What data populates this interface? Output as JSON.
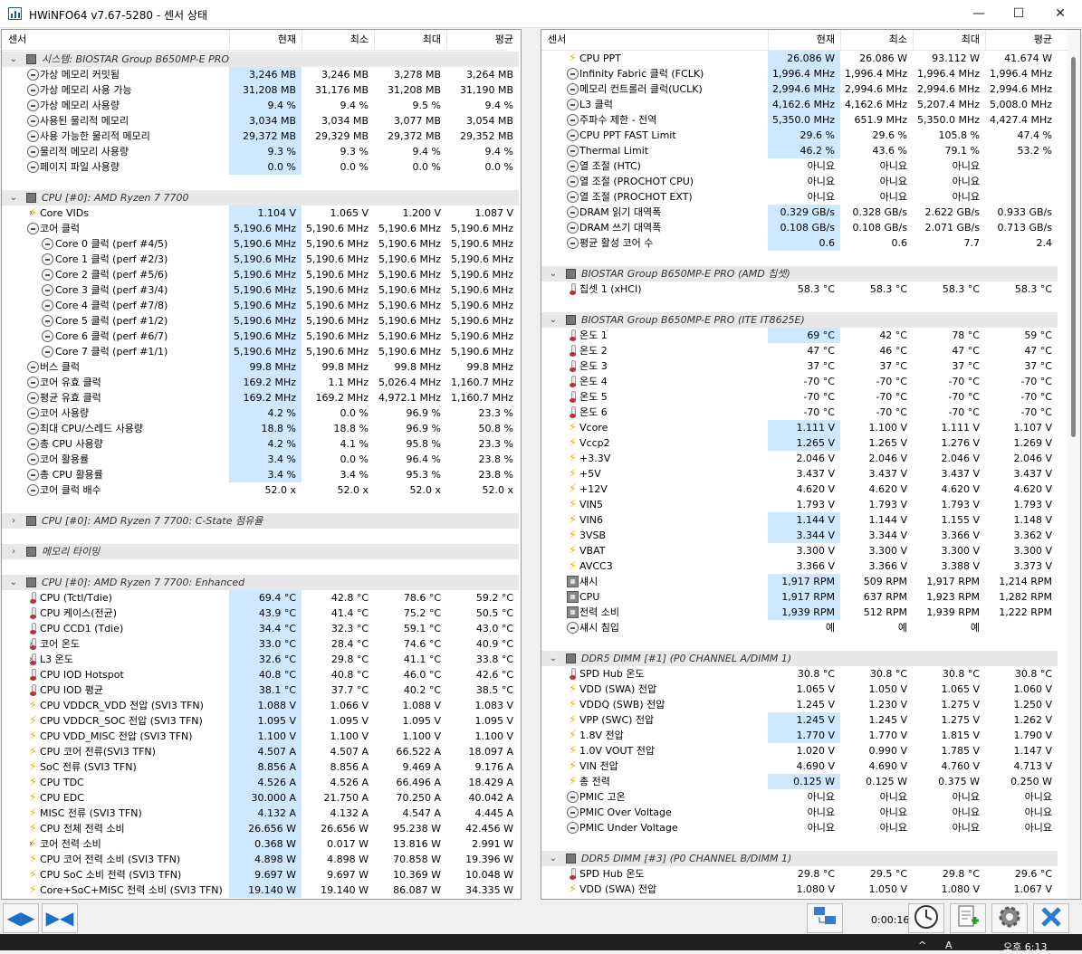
{
  "window": {
    "title": "HWiNFO64 v7.67-5280 - 센서 상태",
    "minimize": "—",
    "maximize": "☐",
    "close": "✕"
  },
  "columns": {
    "sensor": "센서",
    "current": "현재",
    "min": "최소",
    "max": "최대",
    "avg": "평균"
  },
  "left_rows": [
    {
      "t": "s",
      "lvl": 0,
      "ex": "v",
      "icon": "chip",
      "label": "시스템: BIOSTAR Group B650MP-E PRO"
    },
    {
      "lvl": 1,
      "icon": "clock",
      "label": "가상 메모리 커밋됨",
      "v": [
        "3,246 MB",
        "3,246 MB",
        "3,278 MB",
        "3,264 MB"
      ]
    },
    {
      "lvl": 1,
      "icon": "clock",
      "label": "가상 메모리 사용 가능",
      "v": [
        "31,208 MB",
        "31,176 MB",
        "31,208 MB",
        "31,190 MB"
      ]
    },
    {
      "lvl": 1,
      "icon": "clock",
      "label": "가상 메모리 사용량",
      "v": [
        "9.4 %",
        "9.4 %",
        "9.5 %",
        "9.4 %"
      ]
    },
    {
      "lvl": 1,
      "icon": "clock",
      "label": "사용된 물리적 메모리",
      "v": [
        "3,034 MB",
        "3,034 MB",
        "3,077 MB",
        "3,054 MB"
      ]
    },
    {
      "lvl": 1,
      "icon": "clock",
      "label": "사용 가능한 물리적 메모리",
      "v": [
        "29,372 MB",
        "29,329 MB",
        "29,372 MB",
        "29,352 MB"
      ]
    },
    {
      "lvl": 1,
      "icon": "clock",
      "label": "물리적 메모리 사용량",
      "v": [
        "9.3 %",
        "9.3 %",
        "9.4 %",
        "9.4 %"
      ]
    },
    {
      "lvl": 1,
      "icon": "clock",
      "label": "페이지 파일 사용량",
      "v": [
        "0.0 %",
        "0.0 %",
        "0.0 %",
        "0.0 %"
      ]
    },
    {
      "t": "gap"
    },
    {
      "t": "s",
      "lvl": 0,
      "ex": "v",
      "icon": "chip",
      "label": "CPU [#0]: AMD Ryzen 7 7700"
    },
    {
      "lvl": 1,
      "ex": ">",
      "icon": "bolt",
      "label": "Core VIDs",
      "v": [
        "1.104 V",
        "1.065 V",
        "1.200 V",
        "1.087 V"
      ]
    },
    {
      "lvl": 1,
      "ex": "v",
      "icon": "clock",
      "label": "코어 클럭",
      "v": [
        "5,190.6 MHz",
        "5,190.6 MHz",
        "5,190.6 MHz",
        "5,190.6 MHz"
      ]
    },
    {
      "lvl": 2,
      "icon": "clock",
      "label": "Core 0 클럭 (perf #4/5)",
      "v": [
        "5,190.6 MHz",
        "5,190.6 MHz",
        "5,190.6 MHz",
        "5,190.6 MHz"
      ]
    },
    {
      "lvl": 2,
      "icon": "clock",
      "label": "Core 1 클럭 (perf #2/3)",
      "v": [
        "5,190.6 MHz",
        "5,190.6 MHz",
        "5,190.6 MHz",
        "5,190.6 MHz"
      ]
    },
    {
      "lvl": 2,
      "icon": "clock",
      "label": "Core 2 클럭 (perf #5/6)",
      "v": [
        "5,190.6 MHz",
        "5,190.6 MHz",
        "5,190.6 MHz",
        "5,190.6 MHz"
      ]
    },
    {
      "lvl": 2,
      "icon": "clock",
      "label": "Core 3 클럭 (perf #3/4)",
      "v": [
        "5,190.6 MHz",
        "5,190.6 MHz",
        "5,190.6 MHz",
        "5,190.6 MHz"
      ]
    },
    {
      "lvl": 2,
      "icon": "clock",
      "label": "Core 4 클럭 (perf #7/8)",
      "v": [
        "5,190.6 MHz",
        "5,190.6 MHz",
        "5,190.6 MHz",
        "5,190.6 MHz"
      ]
    },
    {
      "lvl": 2,
      "icon": "clock",
      "label": "Core 5 클럭 (perf #1/2)",
      "v": [
        "5,190.6 MHz",
        "5,190.6 MHz",
        "5,190.6 MHz",
        "5,190.6 MHz"
      ]
    },
    {
      "lvl": 2,
      "icon": "clock",
      "label": "Core 6 클럭 (perf #6/7)",
      "v": [
        "5,190.6 MHz",
        "5,190.6 MHz",
        "5,190.6 MHz",
        "5,190.6 MHz"
      ]
    },
    {
      "lvl": 2,
      "icon": "clock",
      "label": "Core 7 클럭 (perf #1/1)",
      "v": [
        "5,190.6 MHz",
        "5,190.6 MHz",
        "5,190.6 MHz",
        "5,190.6 MHz"
      ]
    },
    {
      "lvl": 1,
      "icon": "clock",
      "label": "버스 클럭",
      "v": [
        "99.8 MHz",
        "99.8 MHz",
        "99.8 MHz",
        "99.8 MHz"
      ]
    },
    {
      "lvl": 1,
      "ex": ">",
      "icon": "clock",
      "label": "코어 유효 클럭",
      "v": [
        "169.2 MHz",
        "1.1 MHz",
        "5,026.4 MHz",
        "1,160.7 MHz"
      ]
    },
    {
      "lvl": 1,
      "icon": "clock",
      "label": "평균 유효 클럭",
      "v": [
        "169.2 MHz",
        "169.2 MHz",
        "4,972.1 MHz",
        "1,160.7 MHz"
      ]
    },
    {
      "lvl": 1,
      "ex": ">",
      "icon": "clock",
      "label": "코어 사용량",
      "v": [
        "4.2 %",
        "0.0 %",
        "96.9 %",
        "23.3 %"
      ]
    },
    {
      "lvl": 1,
      "icon": "clock",
      "label": "최대 CPU/스레드 사용량",
      "v": [
        "18.8 %",
        "18.8 %",
        "96.9 %",
        "50.8 %"
      ]
    },
    {
      "lvl": 1,
      "icon": "clock",
      "label": "총 CPU 사용량",
      "v": [
        "4.2 %",
        "4.1 %",
        "95.8 %",
        "23.3 %"
      ]
    },
    {
      "lvl": 1,
      "ex": ">",
      "icon": "clock",
      "label": "코어 활용률",
      "v": [
        "3.4 %",
        "0.0 %",
        "96.4 %",
        "23.8 %"
      ]
    },
    {
      "lvl": 1,
      "icon": "clock",
      "label": "총 CPU 활용률",
      "v": [
        "3.4 %",
        "3.4 %",
        "95.3 %",
        "23.8 %"
      ]
    },
    {
      "lvl": 1,
      "ex": ">",
      "icon": "clock",
      "label": "코어 클럭 배수",
      "v": [
        "52.0 x",
        "52.0 x",
        "52.0 x",
        "52.0 x"
      ],
      "nohl": true
    },
    {
      "t": "gap"
    },
    {
      "t": "s",
      "lvl": 0,
      "ex": ">",
      "icon": "chip",
      "label": "CPU [#0]: AMD Ryzen 7 7700: C-State 점유율"
    },
    {
      "t": "gap"
    },
    {
      "t": "s",
      "lvl": 0,
      "ex": ">",
      "icon": "chip",
      "label": "메모리 타이밍"
    },
    {
      "t": "gap"
    },
    {
      "t": "s",
      "lvl": 0,
      "ex": "v",
      "icon": "chip",
      "label": "CPU [#0]: AMD Ryzen 7 7700: Enhanced"
    },
    {
      "lvl": 1,
      "icon": "therm",
      "label": "CPU (Tctl/Tdie)",
      "v": [
        "69.4 °C",
        "42.8 °C",
        "78.6 °C",
        "59.2 °C"
      ]
    },
    {
      "lvl": 1,
      "icon": "therm",
      "label": "CPU 케이스(전균)",
      "v": [
        "43.9 °C",
        "41.4 °C",
        "75.2 °C",
        "50.5 °C"
      ]
    },
    {
      "lvl": 1,
      "icon": "therm",
      "label": "CPU CCD1 (Tdie)",
      "v": [
        "34.4 °C",
        "32.3 °C",
        "59.1 °C",
        "43.0 °C"
      ]
    },
    {
      "lvl": 1,
      "ex": ">",
      "icon": "therm",
      "label": "코어 온도",
      "v": [
        "33.0 °C",
        "28.4 °C",
        "74.6 °C",
        "40.9 °C"
      ]
    },
    {
      "lvl": 1,
      "ex": ">",
      "icon": "therm",
      "label": "L3 온도",
      "v": [
        "32.6 °C",
        "29.8 °C",
        "41.1 °C",
        "33.8 °C"
      ]
    },
    {
      "lvl": 1,
      "icon": "therm",
      "label": "CPU IOD Hotspot",
      "v": [
        "40.8 °C",
        "40.8 °C",
        "46.0 °C",
        "42.6 °C"
      ]
    },
    {
      "lvl": 1,
      "icon": "therm",
      "label": "CPU IOD 평균",
      "v": [
        "38.1 °C",
        "37.7 °C",
        "40.2 °C",
        "38.5 °C"
      ]
    },
    {
      "lvl": 1,
      "icon": "bolt",
      "label": "CPU VDDCR_VDD 전압 (SVI3 TFN)",
      "v": [
        "1.088 V",
        "1.066 V",
        "1.088 V",
        "1.083 V"
      ]
    },
    {
      "lvl": 1,
      "icon": "bolt",
      "label": "CPU VDDCR_SOC 전압 (SVI3 TFN)",
      "v": [
        "1.095 V",
        "1.095 V",
        "1.095 V",
        "1.095 V"
      ]
    },
    {
      "lvl": 1,
      "icon": "bolt",
      "label": "CPU VDD_MISC 전압 (SVI3 TFN)",
      "v": [
        "1.100 V",
        "1.100 V",
        "1.100 V",
        "1.100 V"
      ]
    },
    {
      "lvl": 1,
      "icon": "bolt",
      "label": "CPU 코어 전류(SVI3 TFN)",
      "v": [
        "4.507 A",
        "4.507 A",
        "66.522 A",
        "18.097 A"
      ]
    },
    {
      "lvl": 1,
      "icon": "bolt",
      "label": "SoC 전류 (SVI3 TFN)",
      "v": [
        "8.856 A",
        "8.856 A",
        "9.469 A",
        "9.176 A"
      ]
    },
    {
      "lvl": 1,
      "icon": "bolt",
      "label": "CPU TDC",
      "v": [
        "4.526 A",
        "4.526 A",
        "66.496 A",
        "18.429 A"
      ]
    },
    {
      "lvl": 1,
      "icon": "bolt",
      "label": "CPU EDC",
      "v": [
        "30.000 A",
        "21.750 A",
        "70.250 A",
        "40.042 A"
      ]
    },
    {
      "lvl": 1,
      "icon": "bolt",
      "label": "MISC 전류 (SVI3 TFN)",
      "v": [
        "4.132 A",
        "4.132 A",
        "4.547 A",
        "4.445 A"
      ]
    },
    {
      "lvl": 1,
      "icon": "bolt",
      "label": "CPU 전체 전력 소비",
      "v": [
        "26.656 W",
        "26.656 W",
        "95.238 W",
        "42.456 W"
      ]
    },
    {
      "lvl": 1,
      "ex": ">",
      "icon": "bolt",
      "label": "코어 전력 소비",
      "v": [
        "0.368 W",
        "0.017 W",
        "13.816 W",
        "2.991 W"
      ]
    },
    {
      "lvl": 1,
      "icon": "bolt",
      "label": "CPU 코어 전력 소비 (SVI3 TFN)",
      "v": [
        "4.898 W",
        "4.898 W",
        "70.858 W",
        "19.396 W"
      ]
    },
    {
      "lvl": 1,
      "icon": "bolt",
      "label": "CPU SoC 소비 전력 (SVI3 TFN)",
      "v": [
        "9.697 W",
        "9.697 W",
        "10.369 W",
        "10.048 W"
      ]
    },
    {
      "lvl": 1,
      "icon": "bolt",
      "label": "Core+SoC+MISC 전력 소비 (SVI3 TFN)",
      "v": [
        "19.140 W",
        "19.140 W",
        "86.087 W",
        "34.335 W"
      ]
    }
  ],
  "right_rows": [
    {
      "lvl": 1,
      "icon": "bolt",
      "label": "CPU PPT",
      "v": [
        "26.086 W",
        "26.086 W",
        "93.112 W",
        "41.674 W"
      ]
    },
    {
      "lvl": 1,
      "icon": "clock",
      "label": "Infinity Fabric 클럭 (FCLK)",
      "v": [
        "1,996.4 MHz",
        "1,996.4 MHz",
        "1,996.4 MHz",
        "1,996.4 MHz"
      ]
    },
    {
      "lvl": 1,
      "icon": "clock",
      "label": "메모리 컨트롤러 클럭(UCLK)",
      "v": [
        "2,994.6 MHz",
        "2,994.6 MHz",
        "2,994.6 MHz",
        "2,994.6 MHz"
      ]
    },
    {
      "lvl": 1,
      "ex": ">",
      "icon": "clock",
      "label": "L3 클럭",
      "v": [
        "4,162.6 MHz",
        "4,162.6 MHz",
        "5,207.4 MHz",
        "5,008.0 MHz"
      ]
    },
    {
      "lvl": 1,
      "icon": "clock",
      "label": "주파수 제한 - 전역",
      "v": [
        "5,350.0 MHz",
        "651.9 MHz",
        "5,350.0 MHz",
        "4,427.4 MHz"
      ]
    },
    {
      "lvl": 1,
      "icon": "clock",
      "label": "CPU PPT FAST Limit",
      "v": [
        "29.6 %",
        "29.6 %",
        "105.8 %",
        "47.4 %"
      ]
    },
    {
      "lvl": 1,
      "icon": "clock",
      "label": "Thermal Limit",
      "v": [
        "46.2 %",
        "43.6 %",
        "79.1 %",
        "53.2 %"
      ]
    },
    {
      "lvl": 1,
      "icon": "clock",
      "label": "열 조절 (HTC)",
      "v": [
        "아니요",
        "아니요",
        "아니요",
        ""
      ],
      "nohl": true
    },
    {
      "lvl": 1,
      "icon": "clock",
      "label": "열 조절 (PROCHOT CPU)",
      "v": [
        "아니요",
        "아니요",
        "아니요",
        ""
      ],
      "nohl": true
    },
    {
      "lvl": 1,
      "icon": "clock",
      "label": "열 조절 (PROCHOT EXT)",
      "v": [
        "아니요",
        "아니요",
        "아니요",
        ""
      ],
      "nohl": true
    },
    {
      "lvl": 1,
      "icon": "clock",
      "label": "DRAM 읽기 대역폭",
      "v": [
        "0.329 GB/s",
        "0.328 GB/s",
        "2.622 GB/s",
        "0.933 GB/s"
      ]
    },
    {
      "lvl": 1,
      "icon": "clock",
      "label": "DRAM 쓰기 대역폭",
      "v": [
        "0.108 GB/s",
        "0.108 GB/s",
        "2.071 GB/s",
        "0.713 GB/s"
      ]
    },
    {
      "lvl": 1,
      "icon": "clock",
      "label": "평균 활성 코어 수",
      "v": [
        "0.6",
        "0.6",
        "7.7",
        "2.4"
      ]
    },
    {
      "t": "gap"
    },
    {
      "t": "s",
      "lvl": 0,
      "ex": "v",
      "icon": "chip",
      "label": "BIOSTAR Group B650MP-E PRO (AMD 칩셋)"
    },
    {
      "lvl": 1,
      "icon": "therm",
      "label": "칩셋 1 (xHCI)",
      "v": [
        "58.3 °C",
        "58.3 °C",
        "58.3 °C",
        "58.3 °C"
      ],
      "nohl": true
    },
    {
      "t": "gap"
    },
    {
      "t": "s",
      "lvl": 0,
      "ex": "v",
      "icon": "chip",
      "label": "BIOSTAR Group B650MP-E PRO (ITE IT8625E)"
    },
    {
      "lvl": 1,
      "icon": "therm",
      "label": "온도 1",
      "v": [
        "69 °C",
        "42 °C",
        "78 °C",
        "59 °C"
      ]
    },
    {
      "lvl": 1,
      "icon": "therm",
      "label": "온도 2",
      "v": [
        "47 °C",
        "46 °C",
        "47 °C",
        "47 °C"
      ],
      "nohl": true
    },
    {
      "lvl": 1,
      "icon": "therm",
      "label": "온도 3",
      "v": [
        "37 °C",
        "37 °C",
        "37 °C",
        "37 °C"
      ],
      "nohl": true
    },
    {
      "lvl": 1,
      "icon": "therm",
      "label": "온도 4",
      "v": [
        "-70 °C",
        "-70 °C",
        "-70 °C",
        "-70 °C"
      ],
      "nohl": true
    },
    {
      "lvl": 1,
      "icon": "therm",
      "label": "온도 5",
      "v": [
        "-70 °C",
        "-70 °C",
        "-70 °C",
        "-70 °C"
      ],
      "nohl": true
    },
    {
      "lvl": 1,
      "icon": "therm",
      "label": "온도 6",
      "v": [
        "-70 °C",
        "-70 °C",
        "-70 °C",
        "-70 °C"
      ],
      "nohl": true
    },
    {
      "lvl": 1,
      "icon": "bolt",
      "label": "Vcore",
      "v": [
        "1.111 V",
        "1.100 V",
        "1.111 V",
        "1.107 V"
      ]
    },
    {
      "lvl": 1,
      "icon": "bolt",
      "label": "Vccp2",
      "v": [
        "1.265 V",
        "1.265 V",
        "1.276 V",
        "1.269 V"
      ]
    },
    {
      "lvl": 1,
      "icon": "bolt",
      "label": "+3.3V",
      "v": [
        "2.046 V",
        "2.046 V",
        "2.046 V",
        "2.046 V"
      ],
      "nohl": true
    },
    {
      "lvl": 1,
      "icon": "bolt",
      "label": "+5V",
      "v": [
        "3.437 V",
        "3.437 V",
        "3.437 V",
        "3.437 V"
      ],
      "nohl": true
    },
    {
      "lvl": 1,
      "icon": "bolt",
      "label": "+12V",
      "v": [
        "4.620 V",
        "4.620 V",
        "4.620 V",
        "4.620 V"
      ],
      "nohl": true
    },
    {
      "lvl": 1,
      "icon": "bolt",
      "label": "VIN5",
      "v": [
        "1.793 V",
        "1.793 V",
        "1.793 V",
        "1.793 V"
      ],
      "nohl": true
    },
    {
      "lvl": 1,
      "icon": "bolt",
      "label": "VIN6",
      "v": [
        "1.144 V",
        "1.144 V",
        "1.155 V",
        "1.148 V"
      ]
    },
    {
      "lvl": 1,
      "icon": "bolt",
      "label": "3VSB",
      "v": [
        "3.344 V",
        "3.344 V",
        "3.366 V",
        "3.362 V"
      ]
    },
    {
      "lvl": 1,
      "icon": "bolt",
      "label": "VBAT",
      "v": [
        "3.300 V",
        "3.300 V",
        "3.300 V",
        "3.300 V"
      ],
      "nohl": true
    },
    {
      "lvl": 1,
      "icon": "bolt",
      "label": "AVCC3",
      "v": [
        "3.366 V",
        "3.366 V",
        "3.388 V",
        "3.373 V"
      ],
      "nohl": true
    },
    {
      "lvl": 1,
      "icon": "fan",
      "label": "섀시",
      "v": [
        "1,917 RPM",
        "509 RPM",
        "1,917 RPM",
        "1,214 RPM"
      ]
    },
    {
      "lvl": 1,
      "icon": "fan",
      "label": "CPU",
      "v": [
        "1,917 RPM",
        "637 RPM",
        "1,923 RPM",
        "1,282 RPM"
      ]
    },
    {
      "lvl": 1,
      "icon": "fan",
      "label": "전력 소비",
      "v": [
        "1,939 RPM",
        "512 RPM",
        "1,939 RPM",
        "1,222 RPM"
      ]
    },
    {
      "lvl": 1,
      "icon": "clock",
      "label": "섀시 침입",
      "v": [
        "예",
        "예",
        "예",
        ""
      ],
      "nohl": true
    },
    {
      "t": "gap"
    },
    {
      "t": "s",
      "lvl": 0,
      "ex": "v",
      "icon": "chip",
      "label": "DDR5 DIMM [#1] (P0 CHANNEL A/DIMM 1)"
    },
    {
      "lvl": 1,
      "icon": "therm",
      "label": "SPD Hub 온도",
      "v": [
        "30.8 °C",
        "30.8 °C",
        "30.8 °C",
        "30.8 °C"
      ],
      "nohl": true
    },
    {
      "lvl": 1,
      "icon": "bolt",
      "label": "VDD (SWA) 전압",
      "v": [
        "1.065 V",
        "1.050 V",
        "1.065 V",
        "1.060 V"
      ],
      "nohl": true
    },
    {
      "lvl": 1,
      "icon": "bolt",
      "label": "VDDQ (SWB) 전압",
      "v": [
        "1.245 V",
        "1.230 V",
        "1.275 V",
        "1.250 V"
      ],
      "nohl": true
    },
    {
      "lvl": 1,
      "icon": "bolt",
      "label": "VPP (SWC) 전압",
      "v": [
        "1.245 V",
        "1.245 V",
        "1.275 V",
        "1.262 V"
      ]
    },
    {
      "lvl": 1,
      "icon": "bolt",
      "label": "1.8V 전압",
      "v": [
        "1.770 V",
        "1.770 V",
        "1.815 V",
        "1.790 V"
      ]
    },
    {
      "lvl": 1,
      "icon": "bolt",
      "label": "1.0V VOUT 전압",
      "v": [
        "1.020 V",
        "0.990 V",
        "1.785 V",
        "1.147 V"
      ],
      "nohl": true
    },
    {
      "lvl": 1,
      "icon": "bolt",
      "label": "VIN 전압",
      "v": [
        "4.690 V",
        "4.690 V",
        "4.760 V",
        "4.713 V"
      ],
      "nohl": true
    },
    {
      "lvl": 1,
      "icon": "bolt",
      "label": "총 전력",
      "v": [
        "0.125 W",
        "0.125 W",
        "0.375 W",
        "0.250 W"
      ]
    },
    {
      "lvl": 1,
      "icon": "clock",
      "label": "PMIC 고온",
      "v": [
        "아니요",
        "아니요",
        "아니요",
        "아니요"
      ],
      "nohl": true
    },
    {
      "lvl": 1,
      "icon": "clock",
      "label": "PMIC Over Voltage",
      "v": [
        "아니요",
        "아니요",
        "아니요",
        "아니요"
      ],
      "nohl": true
    },
    {
      "lvl": 1,
      "icon": "clock",
      "label": "PMIC Under Voltage",
      "v": [
        "아니요",
        "아니요",
        "아니요",
        "아니요"
      ],
      "nohl": true
    },
    {
      "t": "gap"
    },
    {
      "t": "s",
      "lvl": 0,
      "ex": "v",
      "icon": "chip",
      "label": "DDR5 DIMM [#3] (P0 CHANNEL B/DIMM 1)"
    },
    {
      "lvl": 1,
      "icon": "therm",
      "label": "SPD Hub 온도",
      "v": [
        "29.8 °C",
        "29.5 °C",
        "29.8 °C",
        "29.6 °C"
      ],
      "nohl": true
    },
    {
      "lvl": 1,
      "icon": "bolt",
      "label": "VDD (SWA) 전압",
      "v": [
        "1.080 V",
        "1.050 V",
        "1.080 V",
        "1.067 V"
      ],
      "nohl": true
    }
  ],
  "bottom": {
    "timer": "0:00:16",
    "nav_back": "◀▶",
    "nav_fwd": "▶◀"
  },
  "taskbar": {
    "time": "오후 6:13",
    "arrow": "^",
    "a": "A"
  }
}
